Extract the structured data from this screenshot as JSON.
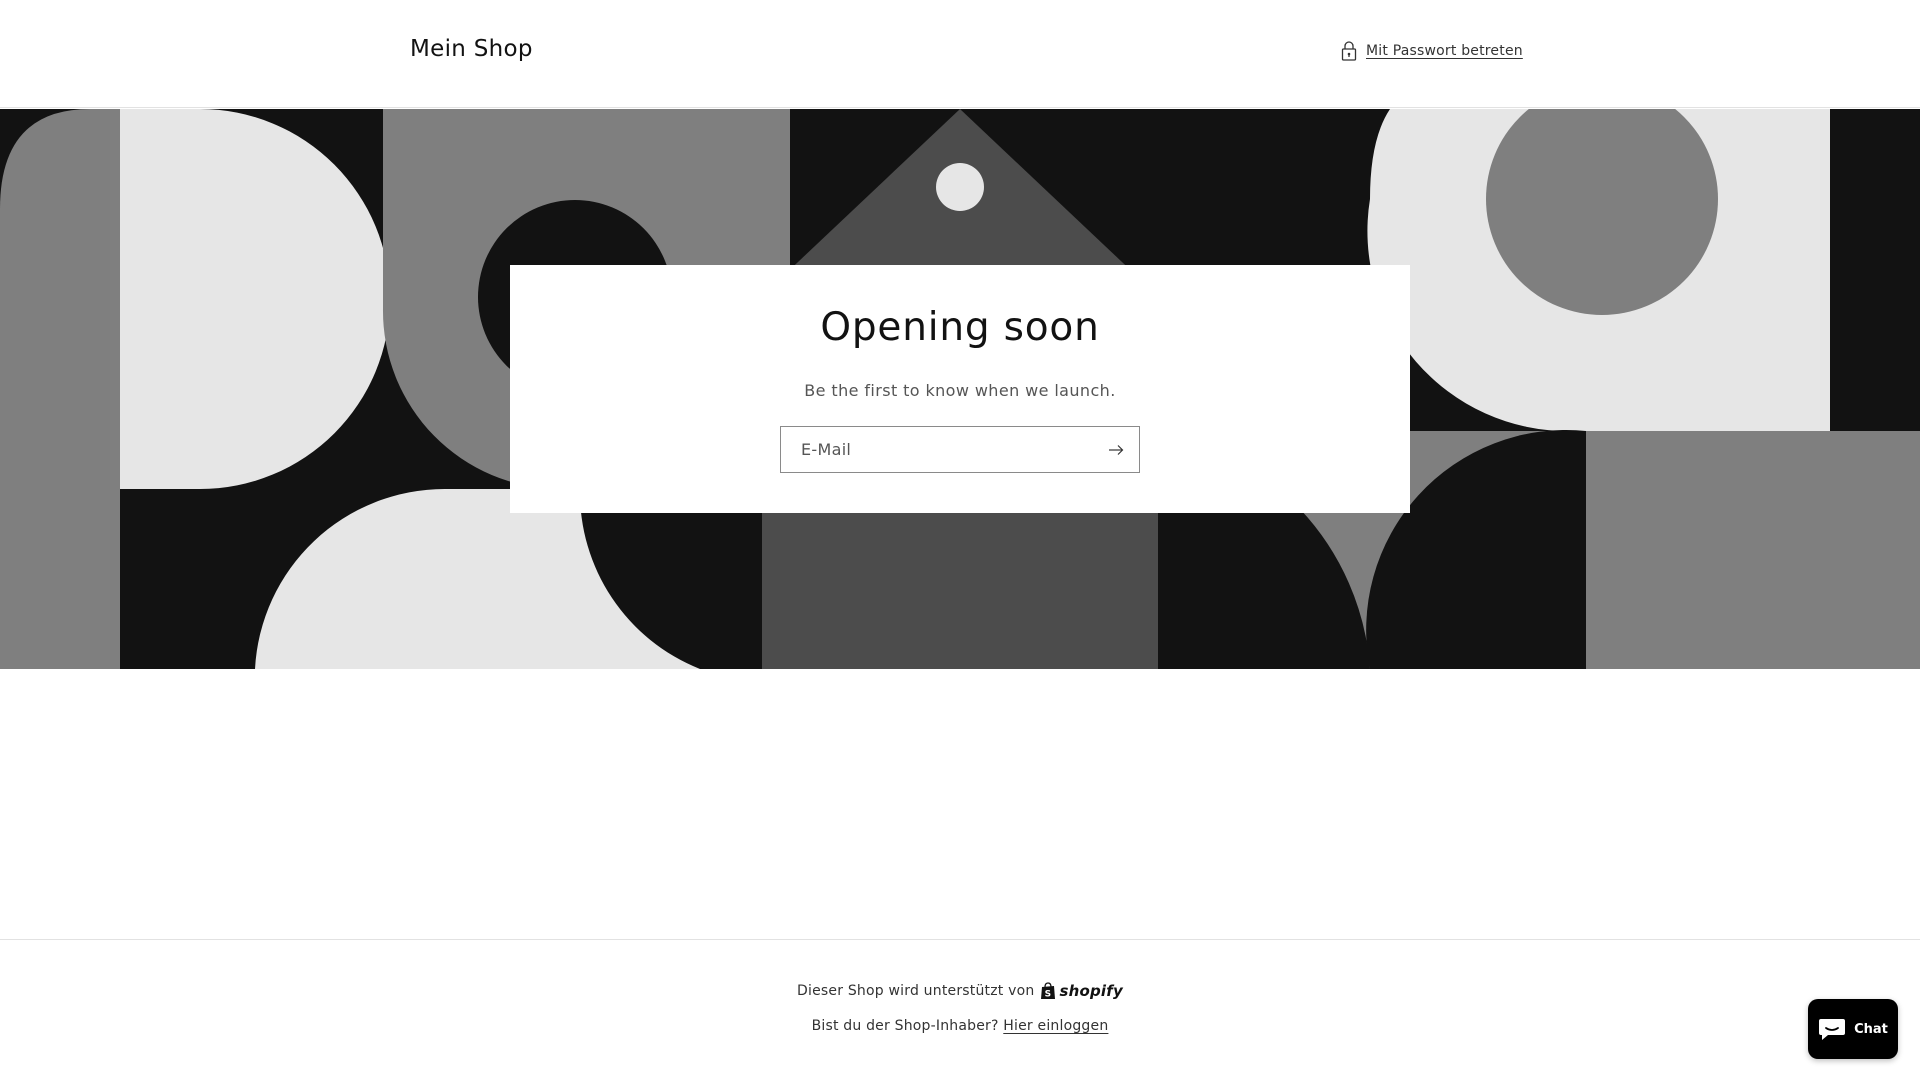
{
  "header": {
    "shop_title": "Mein Shop",
    "password_link": "Mit Passwort betreten",
    "password_icon": "lock-icon"
  },
  "banner": {
    "colors": [
      "#121212",
      "#7f7f7f",
      "#e6e6e6",
      "#4c4c4c"
    ]
  },
  "card": {
    "title": "Opening soon",
    "subtitle": "Be the first to know when we launch.",
    "email_placeholder": "E-Mail",
    "submit_icon": "arrow-right-icon"
  },
  "footer": {
    "powered_by": "Dieser Shop wird unterstützt von",
    "shopify_logo_text": "shopify",
    "owner_question": "Bist du der Shop-Inhaber?",
    "owner_link": "Hier einloggen"
  },
  "chat": {
    "label": "Chat",
    "icon": "chat-bubble-icon"
  }
}
